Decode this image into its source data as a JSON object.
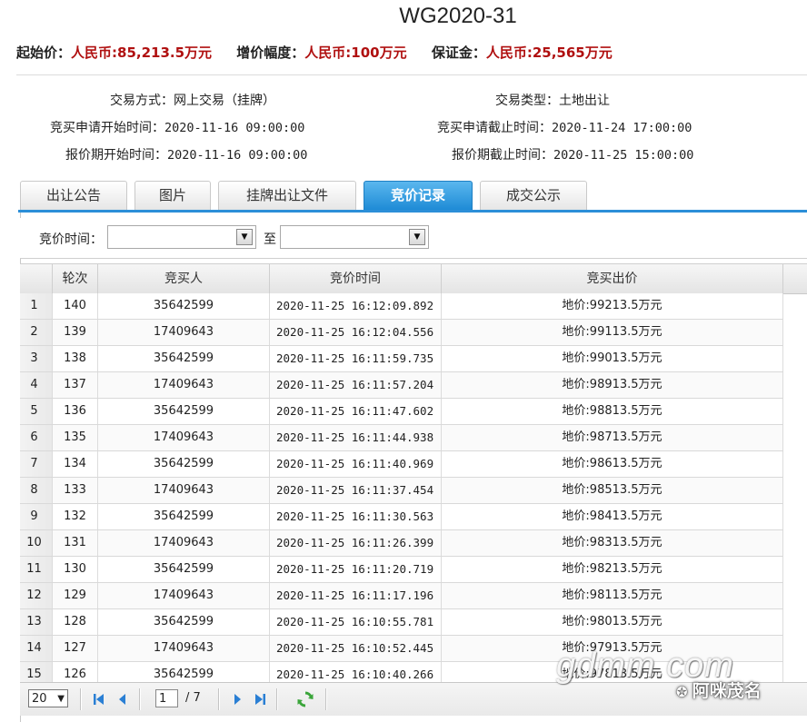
{
  "header": {
    "plot_no": "WG2020-31",
    "start_price_label": "起始价：",
    "start_price_value": "人民币:85,213.5万元",
    "increment_label": "增价幅度：",
    "increment_value": "人民币:100万元",
    "deposit_label": "保证金：",
    "deposit_value": "人民币:25,565万元"
  },
  "info": {
    "trade_method_label": "交易方式：",
    "trade_method_value": "网上交易（挂牌）",
    "trade_type_label": "交易类型：",
    "trade_type_value": "土地出让",
    "apply_start_label": "竞买申请开始时间：",
    "apply_start_value": "2020-11-16 09:00:00",
    "apply_end_label": "竞买申请截止时间：",
    "apply_end_value": "2020-11-24 17:00:00",
    "quote_start_label": "报价期开始时间：",
    "quote_start_value": "2020-11-16 09:00:00",
    "quote_end_label": "报价期截止时间：",
    "quote_end_value": "2020-11-25 15:00:00"
  },
  "tabs": [
    {
      "label": "出让公告",
      "active": false
    },
    {
      "label": "图片",
      "active": false
    },
    {
      "label": "挂牌出让文件",
      "active": false
    },
    {
      "label": "竞价记录",
      "active": true
    },
    {
      "label": "成交公示",
      "active": false
    }
  ],
  "filter": {
    "label": "竞价时间：",
    "from_value": "",
    "to_label": "至",
    "to_value": ""
  },
  "table": {
    "columns": [
      "",
      "轮次",
      "竞买人",
      "竞价时间",
      "竞买出价"
    ],
    "rows": [
      {
        "idx": "1",
        "round": "140",
        "bidder": "35642599",
        "time": "2020-11-25 16:12:09.892",
        "price": "地价:99213.5万元"
      },
      {
        "idx": "2",
        "round": "139",
        "bidder": "17409643",
        "time": "2020-11-25 16:12:04.556",
        "price": "地价:99113.5万元"
      },
      {
        "idx": "3",
        "round": "138",
        "bidder": "35642599",
        "time": "2020-11-25 16:11:59.735",
        "price": "地价:99013.5万元"
      },
      {
        "idx": "4",
        "round": "137",
        "bidder": "17409643",
        "time": "2020-11-25 16:11:57.204",
        "price": "地价:98913.5万元"
      },
      {
        "idx": "5",
        "round": "136",
        "bidder": "35642599",
        "time": "2020-11-25 16:11:47.602",
        "price": "地价:98813.5万元"
      },
      {
        "idx": "6",
        "round": "135",
        "bidder": "17409643",
        "time": "2020-11-25 16:11:44.938",
        "price": "地价:98713.5万元"
      },
      {
        "idx": "7",
        "round": "134",
        "bidder": "35642599",
        "time": "2020-11-25 16:11:40.969",
        "price": "地价:98613.5万元"
      },
      {
        "idx": "8",
        "round": "133",
        "bidder": "17409643",
        "time": "2020-11-25 16:11:37.454",
        "price": "地价:98513.5万元"
      },
      {
        "idx": "9",
        "round": "132",
        "bidder": "35642599",
        "time": "2020-11-25 16:11:30.563",
        "price": "地价:98413.5万元"
      },
      {
        "idx": "10",
        "round": "131",
        "bidder": "17409643",
        "time": "2020-11-25 16:11:26.399",
        "price": "地价:98313.5万元"
      },
      {
        "idx": "11",
        "round": "130",
        "bidder": "35642599",
        "time": "2020-11-25 16:11:20.719",
        "price": "地价:98213.5万元"
      },
      {
        "idx": "12",
        "round": "129",
        "bidder": "17409643",
        "time": "2020-11-25 16:11:17.196",
        "price": "地价:98113.5万元"
      },
      {
        "idx": "13",
        "round": "128",
        "bidder": "35642599",
        "time": "2020-11-25 16:10:55.781",
        "price": "地价:98013.5万元"
      },
      {
        "idx": "14",
        "round": "127",
        "bidder": "17409643",
        "time": "2020-11-25 16:10:52.445",
        "price": "地价:97913.5万元"
      },
      {
        "idx": "15",
        "round": "126",
        "bidder": "35642599",
        "time": "2020-11-25 16:10:40.266",
        "price": "地价:97813.5万元"
      }
    ]
  },
  "pager": {
    "page_size": "20",
    "current_page": "1",
    "total_pages": "/ 7",
    "icons": [
      "first-page-icon",
      "prev-page-icon",
      "next-page-icon",
      "last-page-icon",
      "refresh-icon"
    ]
  },
  "watermark": {
    "site": "gdmm.com",
    "brand": "阿咪茂名"
  },
  "colors": {
    "price_red": "#b01010",
    "tab_active": "#2c8fd8",
    "pager_icon": "#2a7fd4",
    "refresh_green": "#3aa53a"
  }
}
